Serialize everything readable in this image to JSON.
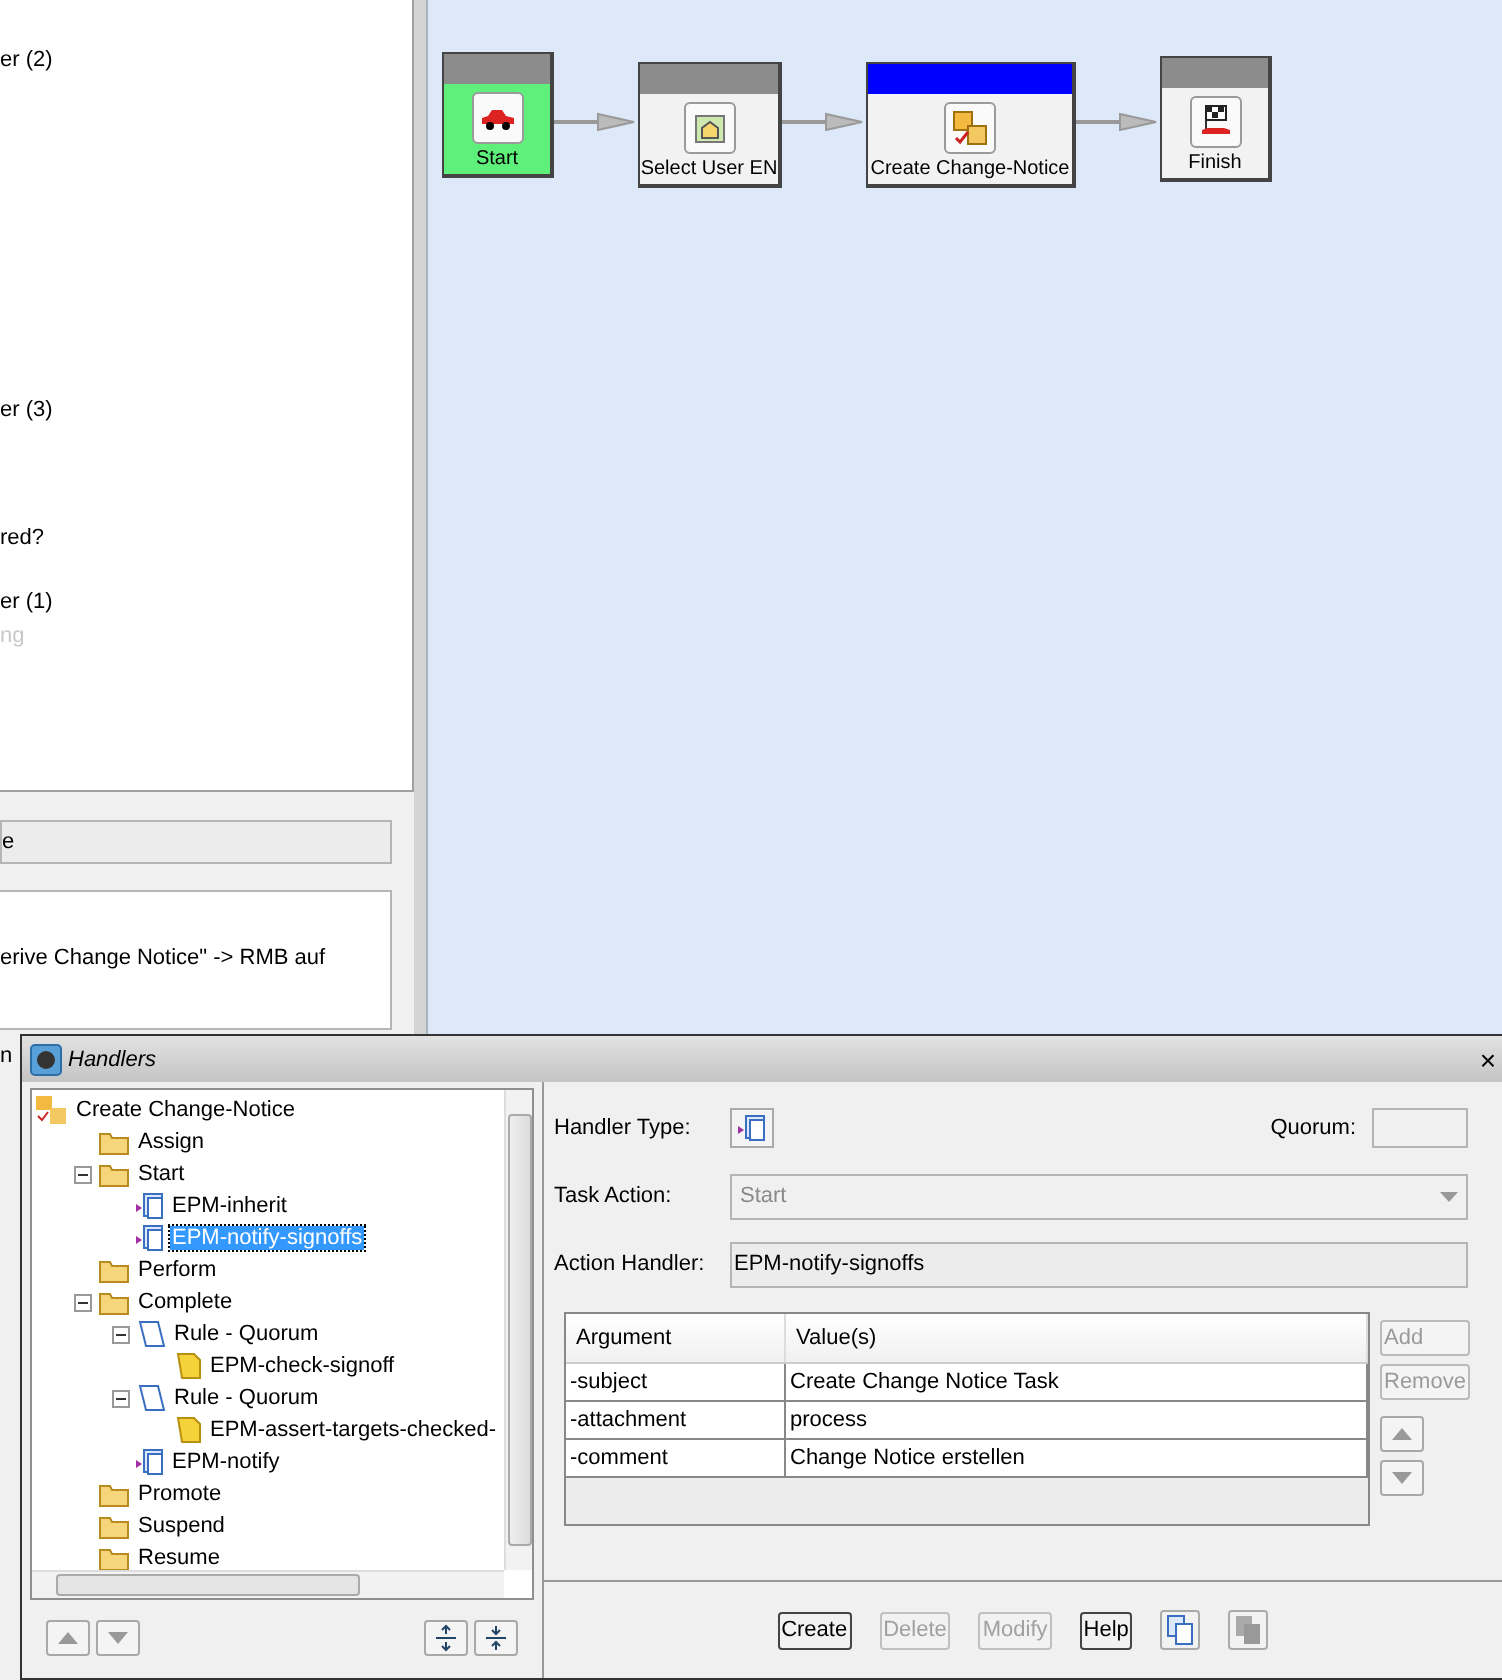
{
  "left_panel": {
    "items": [
      {
        "text": "er (2)",
        "disabled": false
      },
      {
        "text": "er (3)",
        "disabled": false
      },
      {
        "text": "red?",
        "disabled": false
      },
      {
        "text": "er (1)",
        "disabled": false
      },
      {
        "text": "ng",
        "disabled": true
      }
    ],
    "field_value": "e",
    "note": "erive Change Notice\" ->  RMB auf",
    "edge_text": "n"
  },
  "workflow": {
    "nodes": [
      {
        "label": "Start",
        "kind": "start",
        "completed": true,
        "selected": false
      },
      {
        "label": "Select User EN",
        "kind": "select",
        "completed": false,
        "selected": false
      },
      {
        "label": "Create Change-Notice",
        "kind": "task",
        "completed": false,
        "selected": true
      },
      {
        "label": "Finish",
        "kind": "finish",
        "completed": false,
        "selected": false
      }
    ]
  },
  "dialog": {
    "title": "Handlers",
    "close": "×",
    "tree": [
      {
        "label": "Create Change-Notice",
        "kind": "root",
        "selected": false,
        "children": [
          {
            "label": "Assign",
            "kind": "folder",
            "selected": false
          },
          {
            "label": "Start",
            "kind": "folder",
            "expanded": true,
            "selected": false,
            "children": [
              {
                "label": "EPM-inherit",
                "kind": "handler",
                "selected": false
              },
              {
                "label": "EPM-notify-signoffs",
                "kind": "handler",
                "selected": true
              }
            ]
          },
          {
            "label": "Perform",
            "kind": "folder",
            "selected": false
          },
          {
            "label": "Complete",
            "kind": "folder",
            "expanded": true,
            "selected": false,
            "children": [
              {
                "label": "Rule - Quorum",
                "kind": "rule",
                "expanded": true,
                "selected": false,
                "children": [
                  {
                    "label": "EPM-check-signoff",
                    "kind": "rule_handler",
                    "selected": false
                  }
                ]
              },
              {
                "label": "Rule - Quorum",
                "kind": "rule",
                "expanded": true,
                "selected": false,
                "children": [
                  {
                    "label": "EPM-assert-targets-checked-",
                    "kind": "rule_handler",
                    "selected": false
                  }
                ]
              },
              {
                "label": "EPM-notify",
                "kind": "handler",
                "selected": false
              }
            ]
          },
          {
            "label": "Promote",
            "kind": "folder",
            "selected": false
          },
          {
            "label": "Suspend",
            "kind": "folder",
            "selected": false
          },
          {
            "label": "Resume",
            "kind": "folder",
            "selected": false
          }
        ]
      }
    ],
    "handler_type_label": "Handler Type:",
    "quorum_label": "Quorum:",
    "task_action": {
      "label": "Task Action:",
      "value": "Start",
      "disabled": true
    },
    "action_handler": {
      "label": "Action Handler:",
      "value": "EPM-notify-signoffs"
    },
    "table": {
      "columns": [
        "Argument",
        "Value(s)"
      ],
      "rows": [
        [
          "-subject",
          "Create Change Notice Task"
        ],
        [
          "-attachment",
          "process"
        ],
        [
          "-comment",
          "Change Notice erstellen"
        ]
      ]
    },
    "side_buttons": [
      {
        "label": "Add",
        "disabled": true
      },
      {
        "label": "Remove",
        "disabled": true
      }
    ],
    "buttons": [
      {
        "label": "Create",
        "disabled": false
      },
      {
        "label": "Delete",
        "disabled": true
      },
      {
        "label": "Modify",
        "disabled": true
      },
      {
        "label": "Help",
        "disabled": false
      }
    ]
  }
}
